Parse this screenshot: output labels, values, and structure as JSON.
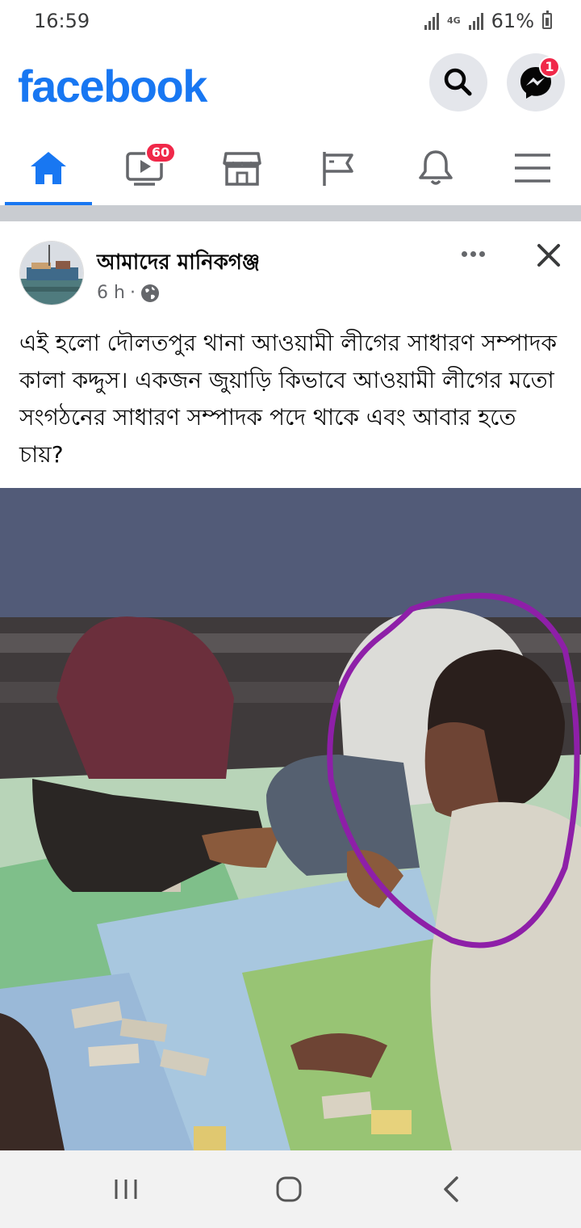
{
  "status": {
    "time": "16:59",
    "network": "4G",
    "battery": "61%"
  },
  "header": {
    "logo": "facebook",
    "messenger_badge": "1",
    "icons": [
      "search-icon",
      "messenger-icon"
    ]
  },
  "tabs": [
    {
      "name": "home",
      "icon": "home-icon",
      "active": true
    },
    {
      "name": "watch",
      "icon": "video-icon",
      "badge": "60"
    },
    {
      "name": "marketplace",
      "icon": "store-icon"
    },
    {
      "name": "pages",
      "icon": "flag-icon"
    },
    {
      "name": "notifications",
      "icon": "bell-icon"
    },
    {
      "name": "menu",
      "icon": "menu-icon"
    }
  ],
  "post": {
    "page_name": "আমাদের মানিকগঞ্জ",
    "time": "6 h",
    "separator": "·",
    "audience_icon": "globe-icon",
    "text": "এই হলো দৌলতপুর থানা আওয়ামী লীগের সাধারণ সম্পাদক কালা কদ্দুস। একজন জুয়াড়ি কিভাবে আওয়ামী লীগের মতো সংগঠনের সাধারণ সম্পাদক পদে থাকে এবং আবার হতে চায়?"
  },
  "colors": {
    "brand": "#1877f2",
    "badge": "#f02849",
    "highlight_circle": "#8e1fa8"
  },
  "navbar": {
    "icons": [
      "recent-apps-icon",
      "home-circle-icon",
      "back-icon"
    ]
  }
}
